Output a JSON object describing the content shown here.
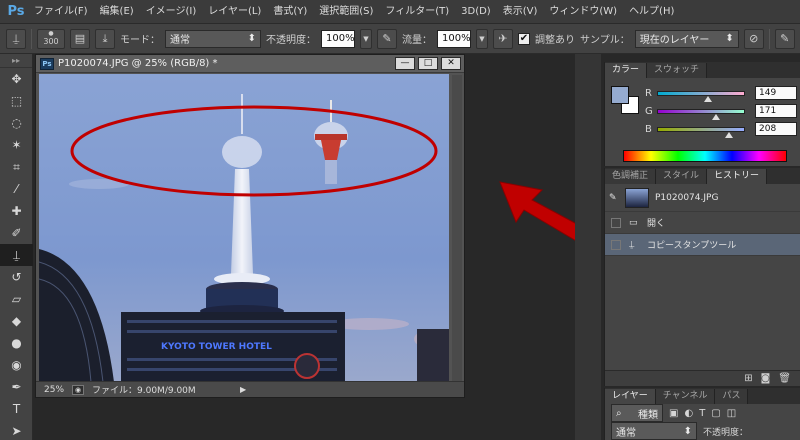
{
  "app": {
    "logo": "Ps"
  },
  "menu": [
    "ファイル(F)",
    "編集(E)",
    "イメージ(I)",
    "レイヤー(L)",
    "書式(Y)",
    "選択範囲(S)",
    "フィルター(T)",
    "3D(D)",
    "表示(V)",
    "ウィンドウ(W)",
    "ヘルプ(H)"
  ],
  "options": {
    "brush_size": "300",
    "mode_label": "モード：",
    "mode_value": "通常",
    "opacity_label": "不透明度：",
    "opacity_value": "100%",
    "flow_label": "流量：",
    "flow_value": "100%",
    "aligned_label": "調整あり",
    "aligned_checked": "✔",
    "sample_label": "サンプル：",
    "sample_value": "現在のレイヤー"
  },
  "document": {
    "ps_badge": "Ps",
    "title": "P1020074.JPG @ 25% (RGB/8) *",
    "min_glyph": "—",
    "max_glyph": "□",
    "close_glyph": "✕",
    "zoom": "25%",
    "file_info": "ファイル：9.00M/9.00M",
    "sign_text": "KYOTO TOWER HOTEL"
  },
  "color_panel": {
    "tabs": [
      "カラー",
      "スウォッチ"
    ],
    "fg_color": "#95abd0",
    "rgb": [
      {
        "label": "R",
        "value": "149",
        "ratio": 0.58,
        "gradient": "linear-gradient(to right,#00abd0,#ffabd0)"
      },
      {
        "label": "G",
        "value": "171",
        "ratio": 0.67,
        "gradient": "linear-gradient(to right,#9500d0,#95ffd0)"
      },
      {
        "label": "B",
        "value": "208",
        "ratio": 0.82,
        "gradient": "linear-gradient(to right,#95ab00,#95abff)"
      }
    ]
  },
  "history_panel": {
    "tabs": [
      "色調補正",
      "スタイル",
      "ヒストリー"
    ],
    "snapshot": "P1020074.JPG",
    "items": [
      {
        "label": "開く",
        "icon": "document-icon"
      },
      {
        "label": "コピースタンプツール",
        "icon": "stamp-icon"
      }
    ]
  },
  "layers_panel": {
    "tabs": [
      "レイヤー",
      "チャンネル",
      "パス"
    ],
    "filter_label": "種類",
    "blend_mode": "通常",
    "opacity_label": "不透明度："
  },
  "accent": {
    "annotation": "#c00000",
    "selection": "#5a6677"
  }
}
